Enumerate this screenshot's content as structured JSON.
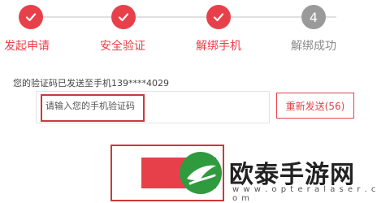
{
  "steps": [
    {
      "label": "发起申请",
      "status": "done"
    },
    {
      "label": "安全验证",
      "status": "done"
    },
    {
      "label": "解绑手机",
      "status": "done"
    },
    {
      "label": "解绑成功",
      "status": "todo",
      "number": "4"
    }
  ],
  "hint": "您的验证码已发送至手机139****4029",
  "code_input": {
    "placeholder": "请输入您的手机验证码",
    "value": ""
  },
  "resend_button": "重新发送(56)",
  "submit_button": "",
  "watermark": {
    "text": "欧泰手游网",
    "url": "w w w . o p t e r a l a s e r . c o m"
  },
  "colors": {
    "accent": "#e8404a",
    "inactive": "#9a9a9a"
  }
}
